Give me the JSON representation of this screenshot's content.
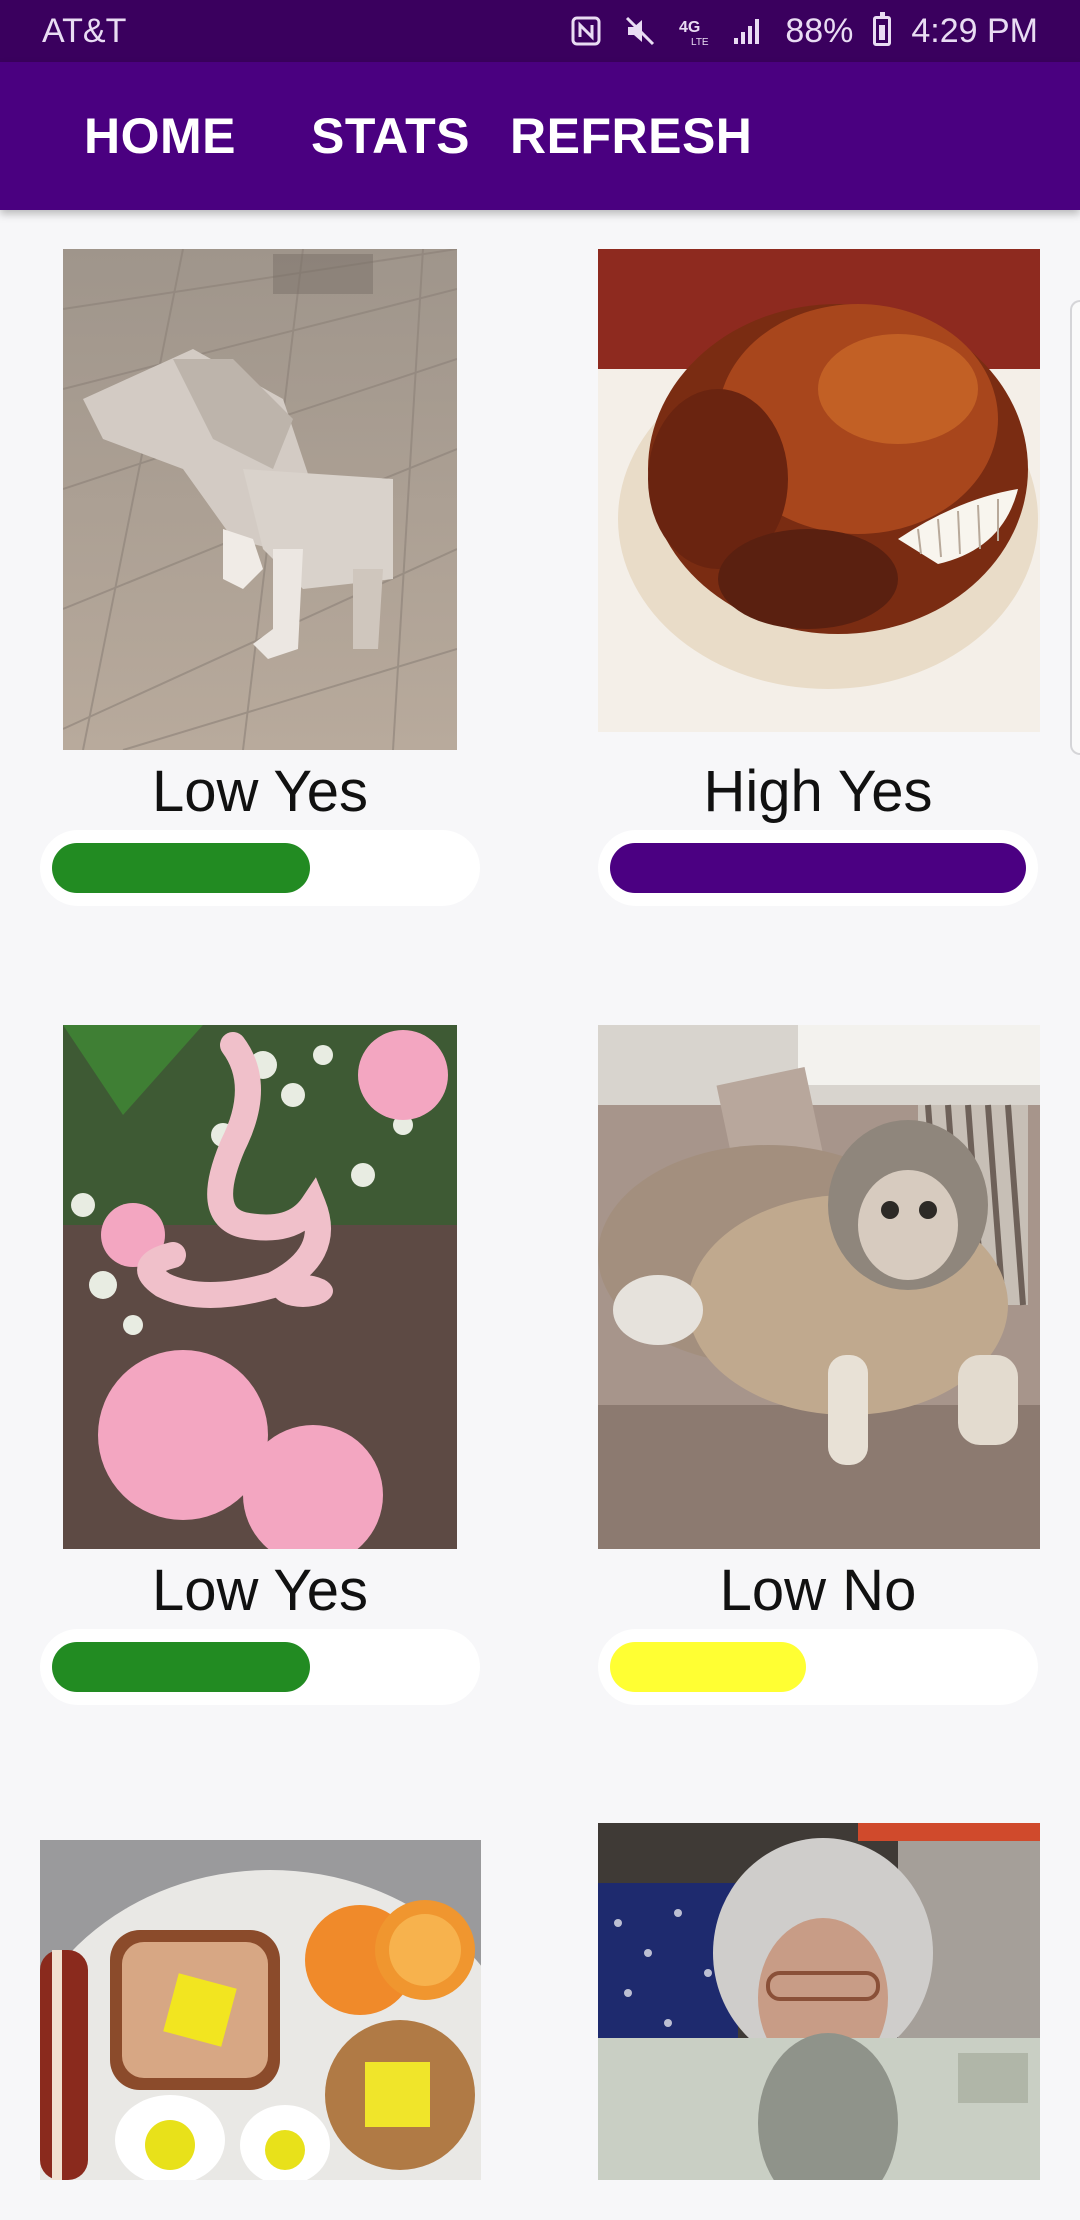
{
  "status_bar": {
    "carrier": "AT&T",
    "network": "4G LTE",
    "battery": "88%",
    "time": "4:29 PM",
    "icons": [
      "nfc-icon",
      "mute-icon",
      "lte-icon",
      "signal-icon",
      "battery-icon"
    ]
  },
  "nav": {
    "home": "HOME",
    "stats": "STATS",
    "refresh": "REFRESH",
    "color": "#4a0080"
  },
  "cards": [
    {
      "label": "Low Yes",
      "level": 0.62,
      "color": "#228b22",
      "image": "low-poly-dog-photo"
    },
    {
      "label": "High Yes",
      "level": 1.0,
      "color": "#4b0082",
      "image": "roast-turkey-with-teeth-photo"
    },
    {
      "label": "Low Yes",
      "level": 0.62,
      "color": "#228b22",
      "image": "pink-snake-with-flowers-photo"
    },
    {
      "label": "Low No",
      "level": 0.47,
      "color": "#ffff33",
      "image": "cat-face-dog-on-couch-photo"
    },
    {
      "image": "breakfast-cookies-photo"
    },
    {
      "image": "woman-with-dollar-bill-photo"
    }
  ]
}
